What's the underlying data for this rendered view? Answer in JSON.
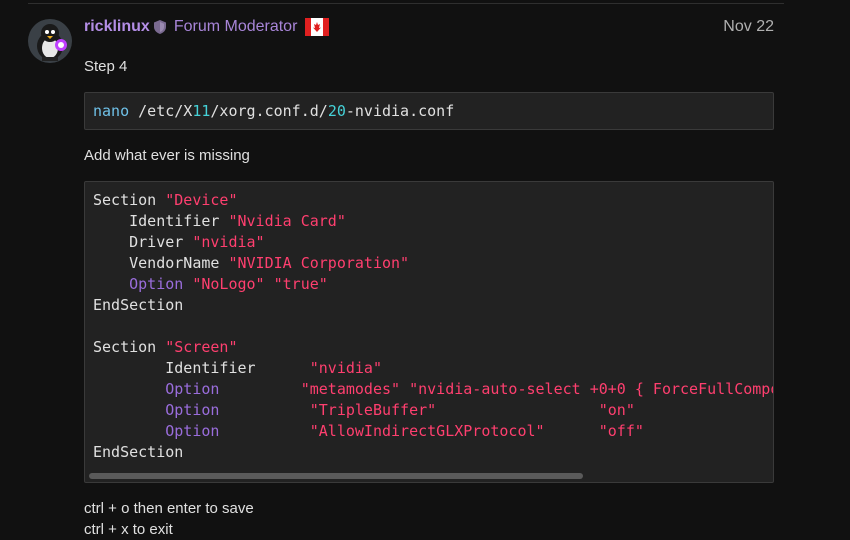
{
  "post": {
    "username": "ricklinux",
    "user_title": "Forum Moderator",
    "date": "Nov 22",
    "step_text": "Step 4",
    "add_text": "Add what ever is missing",
    "save_text": "ctrl + o then enter to save",
    "exit_text": "ctrl + x to exit"
  },
  "code1": {
    "cmd": "nano",
    "path_a": " /etc/X",
    "path_num1": "11",
    "path_b": "/xorg.conf.d/",
    "path_num2": "20",
    "path_c": "-nvidia.conf"
  },
  "code2": {
    "l1_a": "Section ",
    "l1_b": "\"Device\"",
    "l2_a": "    Identifier ",
    "l2_b": "\"Nvidia Card\"",
    "l3_a": "    Driver ",
    "l3_b": "\"nvidia\"",
    "l4_a": "    VendorName ",
    "l4_b": "\"NVIDIA Corporation\"",
    "l5_a": "    Option",
    "l5_b": " \"NoLogo\" \"true\"",
    "l6": "EndSection",
    "l8_a": "Section ",
    "l8_b": "\"Screen\"",
    "l9_a": "        Identifier      ",
    "l9_b": "\"nvidia\"",
    "l10_a": "        Option",
    "l10_b": "         \"metamodes\" \"nvidia-auto-select +0+0 { ForceFullCompo",
    "l11_a": "        Option",
    "l11_b": "          \"TripleBuffer\"                  \"on\"",
    "l12_a": "        Option",
    "l12_b": "          \"AllowIndirectGLXProtocol\"      \"off\"",
    "l13": "EndSection"
  },
  "colors": {
    "accent": "#b48ee6",
    "string": "#ff3f6f",
    "keyword": "#9a6ddc",
    "number": "#45d2d8"
  },
  "icons": {
    "shield": "shield-icon",
    "flag": "canada-flag-icon",
    "avatar": "tux-penguin-avatar"
  }
}
